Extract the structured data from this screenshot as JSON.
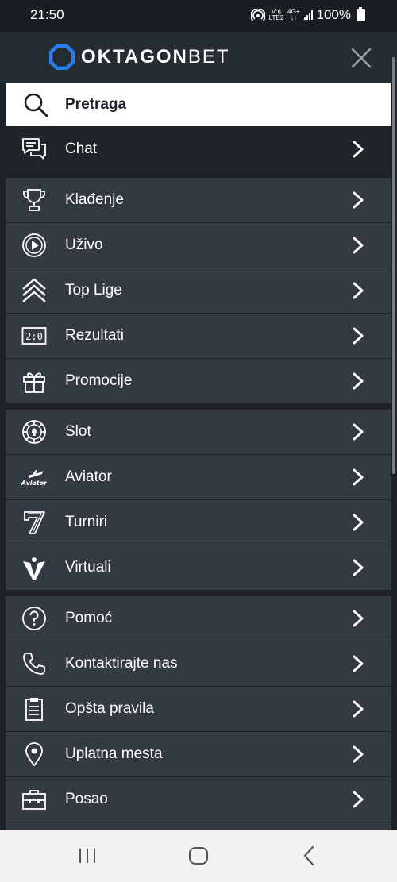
{
  "status": {
    "time": "21:50",
    "network_top": "Vo)",
    "network_bottom": "LTE2",
    "data_top": "4G+",
    "data_bottom": "↓↑",
    "battery": "100%"
  },
  "header": {
    "logo_bold": "OKTAGON",
    "logo_light": "BET",
    "brand_color": "#2b7de9"
  },
  "search": {
    "label": "Pretraga"
  },
  "groups": {
    "chat": "Chat",
    "sports": [
      "Klađenje",
      "Uživo",
      "Top Lige",
      "Rezultati",
      "Promocije"
    ],
    "casino": [
      "Slot",
      "Aviator",
      "Turniri",
      "Virtuali"
    ],
    "info": [
      "Pomoć",
      "Kontaktirajte nas",
      "Opšta pravila",
      "Uplatna mesta",
      "Posao"
    ]
  },
  "icons": {
    "rezultati_text": "2:0",
    "aviator_text": "Aviator"
  }
}
